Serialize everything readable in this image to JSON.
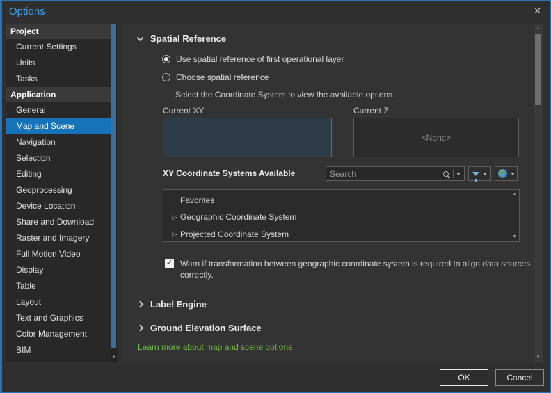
{
  "window": {
    "title": "Options"
  },
  "icons": {
    "close": "✕",
    "check": "✓",
    "arrow_up": "▲",
    "arrow_down": "▼",
    "expander": "▷"
  },
  "sidebar": {
    "sections": [
      {
        "label": "Project",
        "items": [
          {
            "label": "Current Settings"
          },
          {
            "label": "Units"
          },
          {
            "label": "Tasks"
          }
        ]
      },
      {
        "label": "Application",
        "items": [
          {
            "label": "General"
          },
          {
            "label": "Map and Scene",
            "selected": true
          },
          {
            "label": "Navigation"
          },
          {
            "label": "Selection"
          },
          {
            "label": "Editing"
          },
          {
            "label": "Geoprocessing"
          },
          {
            "label": "Device Location"
          },
          {
            "label": "Share and Download"
          },
          {
            "label": "Raster and Imagery"
          },
          {
            "label": "Full Motion Video"
          },
          {
            "label": "Display"
          },
          {
            "label": "Table"
          },
          {
            "label": "Layout"
          },
          {
            "label": "Text and Graphics"
          },
          {
            "label": "Color Management"
          },
          {
            "label": "BIM"
          }
        ]
      }
    ]
  },
  "content": {
    "spatial_reference": {
      "title": "Spatial Reference",
      "radio_first_layer_label": "Use spatial reference of first operational layer",
      "radio_choose_label": "Choose spatial reference",
      "hint": "Select the Coordinate System to view the available options.",
      "current_xy_label": "Current XY",
      "current_z_label": "Current Z",
      "current_z_value": "<None>",
      "xy_systems_label": "XY Coordinate Systems Available",
      "search_placeholder": "Search",
      "list": [
        {
          "label": "Favorites",
          "expandable": false
        },
        {
          "label": "Geographic Coordinate System",
          "expandable": true
        },
        {
          "label": "Projected Coordinate System",
          "expandable": true
        }
      ],
      "warning": "Warn if transformation between geographic coordinate system is required to align data sources correctly."
    },
    "collapsed_sections": [
      {
        "title": "Label Engine"
      },
      {
        "title": "Ground Elevation Surface"
      }
    ],
    "learn_more": "Learn more about map and scene options"
  },
  "footer": {
    "ok_label": "OK",
    "cancel_label": "Cancel"
  },
  "colors": {
    "accent_blue": "#1673b9",
    "title_blue": "#3f9ee8",
    "link_green": "#6fbf43"
  }
}
